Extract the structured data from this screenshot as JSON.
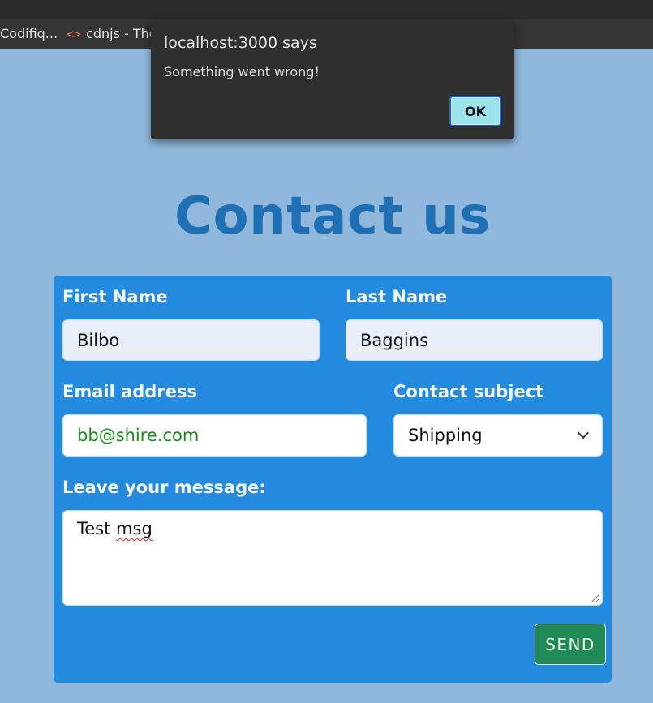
{
  "browser": {
    "bookmarks": [
      {
        "label": "Codifiq..."
      },
      {
        "label": "cdnjs - The",
        "icon": "code-brackets-icon"
      }
    ]
  },
  "dialog": {
    "title": "localhost:3000 says",
    "message": "Something went wrong!",
    "ok_label": "OK"
  },
  "page": {
    "title": "Contact us"
  },
  "form": {
    "first_name_label": "First Name",
    "first_name_value": "Bilbo",
    "last_name_label": "Last Name",
    "last_name_value": "Baggins",
    "email_label": "Email address",
    "email_value": "bb@shire.com",
    "subject_label": "Contact subject",
    "subject_value": "Shipping",
    "message_label": "Leave your message:",
    "message_word1": "Test",
    "message_word2": "msg",
    "send_label": "SEND"
  },
  "colors": {
    "page_bg": "#8fb8dc",
    "form_bg": "#238ade",
    "title": "#1f6fb4",
    "send_button": "#1f8a55",
    "ok_button": "#9ae3ea",
    "email_text": "#1a8a1a"
  }
}
